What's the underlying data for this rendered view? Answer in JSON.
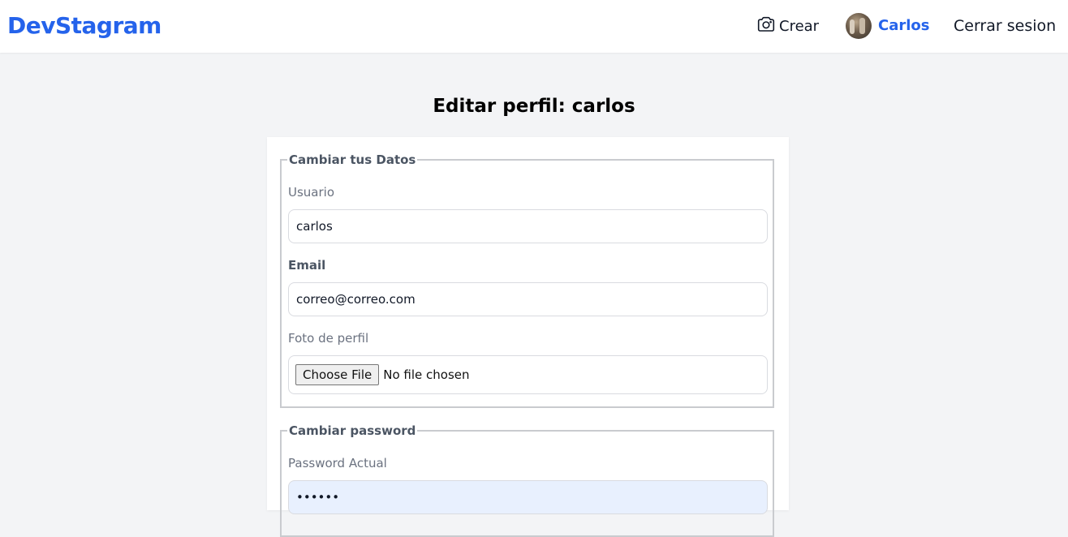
{
  "header": {
    "logo": "DevStagram",
    "crear_label": "Crear",
    "user_name": "Carlos",
    "logout_label": "Cerrar sesion"
  },
  "page": {
    "title": "Editar perfil: carlos"
  },
  "datos": {
    "legend": "Cambiar tus Datos",
    "usuario_label": "Usuario",
    "usuario_value": "carlos",
    "email_label": "Email",
    "email_value": "correo@correo.com",
    "foto_label": "Foto de perfil",
    "file_button": "Choose File",
    "file_status": "No file chosen"
  },
  "password": {
    "legend": "Cambiar password",
    "actual_label": "Password Actual",
    "actual_value": "••••••"
  },
  "colors": {
    "brand": "#2563eb",
    "background": "#f3f4f6",
    "autofill": "#e8f0fe"
  }
}
